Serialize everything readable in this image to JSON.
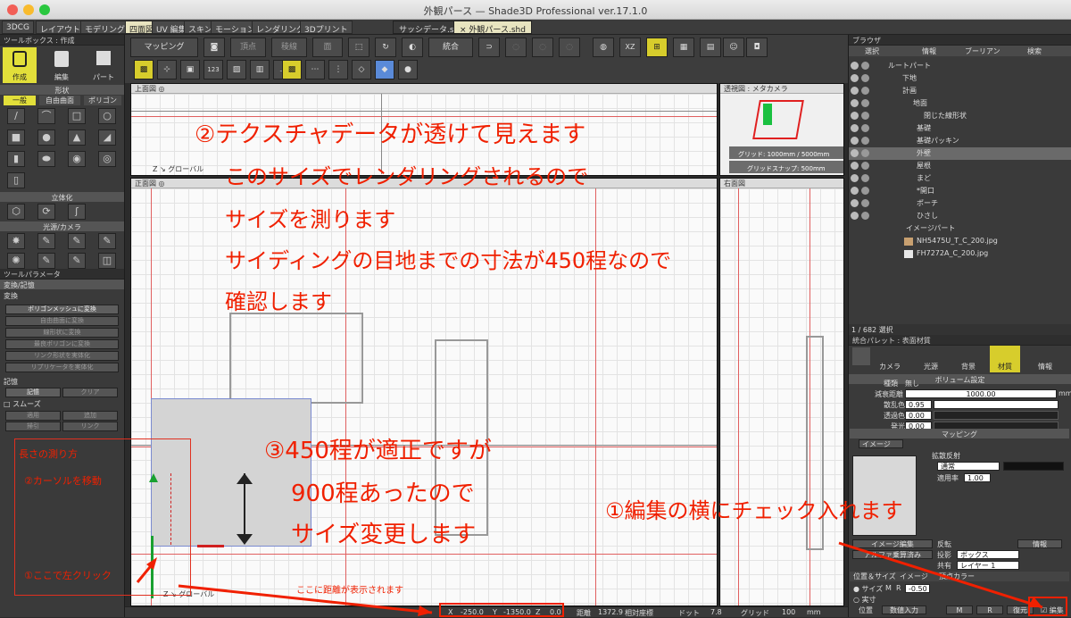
{
  "window": {
    "title": "外観パース — Shade3D Professional ver.17.1.0"
  },
  "top_tabs": [
    "3DCG",
    "レイアウト",
    "モデリング",
    "四面図",
    "UV 編集",
    "スキン",
    "モーション",
    "レンダリング",
    "3Dプリント"
  ],
  "doc_tabs": [
    "サッシデータ.shd",
    "× 外観パース.shd"
  ],
  "toolbox": {
    "title": "ツールボックス : 作成",
    "modes": [
      "作成",
      "編集",
      "パート"
    ],
    "shape_section": "形状",
    "shape_tabs": [
      "一般",
      "自由曲面",
      "ポリゴン"
    ],
    "solid_section": "立体化",
    "light_section": "光源/カメラ"
  },
  "tool_params": {
    "title": "ツールパラメータ",
    "section1": "変換/記憶",
    "convert_label": "変換",
    "buttons": [
      "ポリゴンメッシュに変換",
      "自由曲面に変換",
      "線形状に変換",
      "最良ポリゴンに変換",
      "リンク形状を実体化",
      "リプリケータを実体化"
    ],
    "memory_label": "記憶",
    "memory_buttons": [
      "記憶",
      "クリア"
    ],
    "smooth_label": "スムーズ",
    "smooth_buttons": [
      "適用",
      "追加",
      "掃引",
      "リンク"
    ]
  },
  "toolbar": {
    "mapping": "マッピング",
    "vertex": "頂点",
    "edge": "稜線",
    "face": "面",
    "merge": "統合"
  },
  "viewports": {
    "top": {
      "label": "上面図",
      "global": "グローバル"
    },
    "perspective": {
      "label": "透視図 : メタカメラ",
      "grid": "グリッド: 1000mm / 5000mm",
      "snap": "グリッドスナップ: 500mm"
    },
    "front": {
      "label": "正面図",
      "global": "グローバル"
    },
    "right": {
      "label": "右面図"
    }
  },
  "browser": {
    "title": "ブラウザ",
    "tabs": [
      "選択",
      "情報",
      "ブーリアン",
      "検索"
    ],
    "items": [
      "ルートパート",
      "下地",
      "計画",
      "地面",
      "閉じた線形状",
      "基礎",
      "基礎パッキン",
      "外壁",
      "屋根",
      "まど",
      "*開口",
      "ポーチ",
      "ひさし",
      "イメージパート",
      "NH5475U_T_C_200.jpg",
      "FH7272A_C_200.jpg"
    ],
    "selection": "1 / 682 選択"
  },
  "palette": {
    "title": "統合パレット : 表面材質",
    "tabs": [
      "カメラ",
      "光源",
      "背景",
      "材質",
      "情報"
    ],
    "section_top": "ボリューム設定",
    "type_label": "種類",
    "type_value": "無し",
    "decay_label": "減衰距離",
    "decay_value": "1000.00",
    "decay_unit": "mm",
    "scatter_label": "散乱色",
    "scatter_value": "0.95",
    "transparency_label": "透過色",
    "transparency_value": "0.00",
    "emission_label": "発光",
    "emission_value": "0.00",
    "mapping_section": "マッピング",
    "image_label": "イメージ",
    "diffuse_label": "拡散反射",
    "mode_value": "通常",
    "apply_label": "適用率",
    "apply_value": "1.00",
    "edit_image": "イメージ編集",
    "alpha_label": "アルファ乗算済み",
    "invert_label": "反転",
    "info_btn": "情報",
    "projection_label": "投影",
    "projection_value": "ボックス",
    "share_label": "共有",
    "layer_value": "レイヤー 1",
    "pos_size_tab": "位置＆サイズ",
    "image_tab": "イメージ",
    "vertex_tab": "頂点カラー",
    "size_label": "サイズ",
    "size_m": "M",
    "size_r": "R",
    "size_value": "-0.50",
    "real_label": "実寸",
    "pos_label": "位置",
    "numeric_input": "数値入力",
    "pos_m": "M",
    "pos_r": "R",
    "restore": "復元",
    "edit": "編集"
  },
  "status": {
    "x_label": "X",
    "x": "-250.0",
    "y_label": "Y",
    "y": "-1350.0",
    "z_label": "Z",
    "z": "0.0",
    "dist_label": "距離",
    "dist": "1372.9",
    "coord": "相対座標",
    "dot_label": "ドット",
    "dot": "7.8",
    "grid_label": "グリッド",
    "grid": "100",
    "unit": "mm"
  },
  "annotations": {
    "a2": "②テクスチャデータが透けて見えます",
    "a2_l2": "このサイズでレンダリングされるので",
    "a2_l3": "サイズを測ります",
    "a2_l4": "サイディングの目地までの寸法が450程なので",
    "a2_l5": "確認します",
    "a3": "③450程が適正ですが",
    "a3_l2": "900程あったので",
    "a3_l3": "サイズ変更します",
    "a1": "①編集の横にチェック入れます",
    "box_title": "長さの測り方",
    "box_step2": "②カーソルを移動",
    "box_step1": "①ここで左クリック",
    "distance_note": "ここに距離が表示されます"
  }
}
